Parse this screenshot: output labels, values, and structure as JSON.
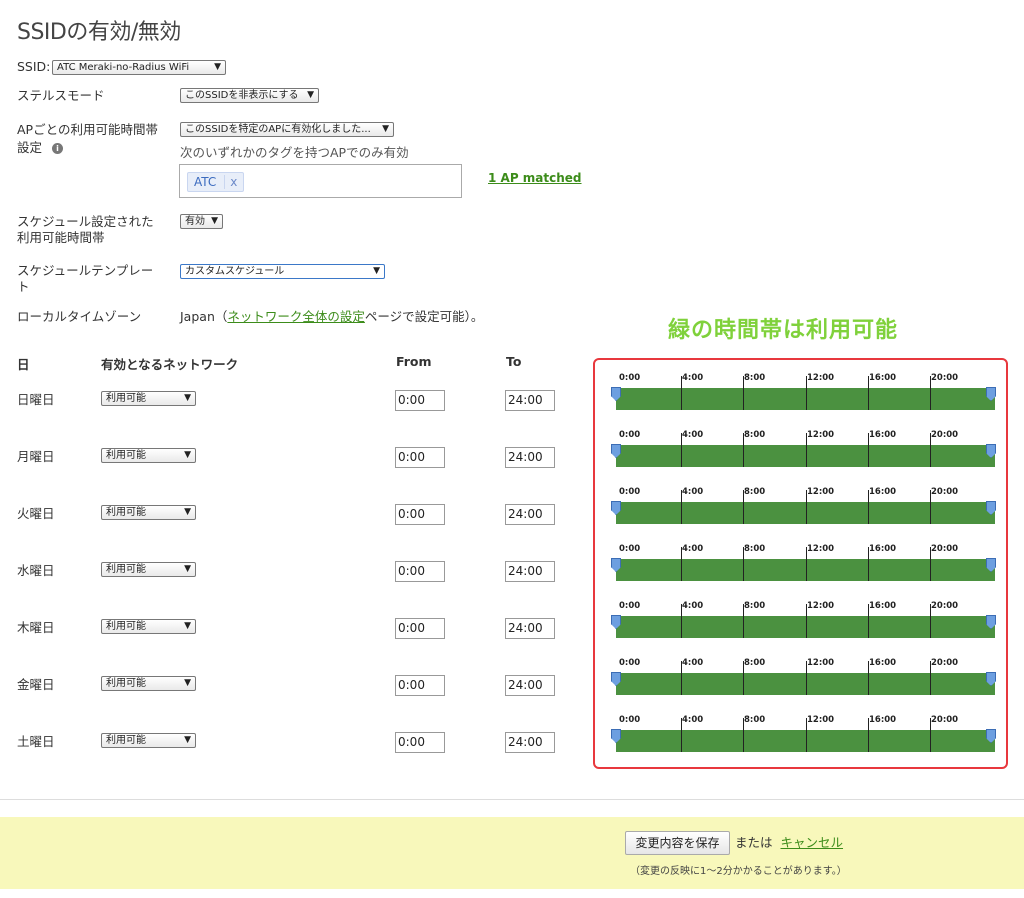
{
  "page": {
    "title": "SSIDの有効/無効"
  },
  "ssid": {
    "label": "SSID:",
    "value": "ATC Meraki-no-Radius WiFi"
  },
  "stealth": {
    "label": "ステルスモード",
    "value": "このSSIDを非表示にする"
  },
  "ap_availability": {
    "label_line1": "APごとの利用可能時間帯",
    "label_line2": "設定",
    "info_icon": "info-icon",
    "value": "このSSIDを特定のAPに有効化しました...",
    "hint": "次のいずれかのタグを持つAPでのみ有効",
    "tag": "ATC",
    "tag_remove": "x",
    "matched": "1 AP matched"
  },
  "scheduled": {
    "label_line1": "スケジュール設定された",
    "label_line2": "利用可能時間帯",
    "value": "有効"
  },
  "template": {
    "label_line1": "スケジュールテンプレー",
    "label_line2": "ト",
    "value": "カスタムスケジュール"
  },
  "timezone": {
    "label": "ローカルタイムゾーン",
    "value_prefix": "Japan（",
    "link": "ネットワーク全体の設定",
    "value_suffix": "ページで設定可能）。"
  },
  "annotation": "緑の時間帯は利用可能",
  "table": {
    "headers": {
      "day": "日",
      "network": "有効となるネットワーク",
      "from": "From",
      "to": "To"
    },
    "rows": [
      {
        "day": "日曜日",
        "status": "利用可能",
        "from": "0:00",
        "to": "24:00"
      },
      {
        "day": "月曜日",
        "status": "利用可能",
        "from": "0:00",
        "to": "24:00"
      },
      {
        "day": "火曜日",
        "status": "利用可能",
        "from": "0:00",
        "to": "24:00"
      },
      {
        "day": "水曜日",
        "status": "利用可能",
        "from": "0:00",
        "to": "24:00"
      },
      {
        "day": "木曜日",
        "status": "利用可能",
        "from": "0:00",
        "to": "24:00"
      },
      {
        "day": "金曜日",
        "status": "利用可能",
        "from": "0:00",
        "to": "24:00"
      },
      {
        "day": "土曜日",
        "status": "利用可能",
        "from": "0:00",
        "to": "24:00"
      }
    ],
    "timeline_labels": [
      "0:00",
      "4:00",
      "8:00",
      "12:00",
      "16:00",
      "20:00"
    ],
    "available_color": "#4b9140"
  },
  "footer": {
    "save_label": "変更内容を保存",
    "or_text": "または",
    "cancel_label": "キャンセル",
    "note": "（変更の反映に1～2分かかることがあります。）"
  }
}
